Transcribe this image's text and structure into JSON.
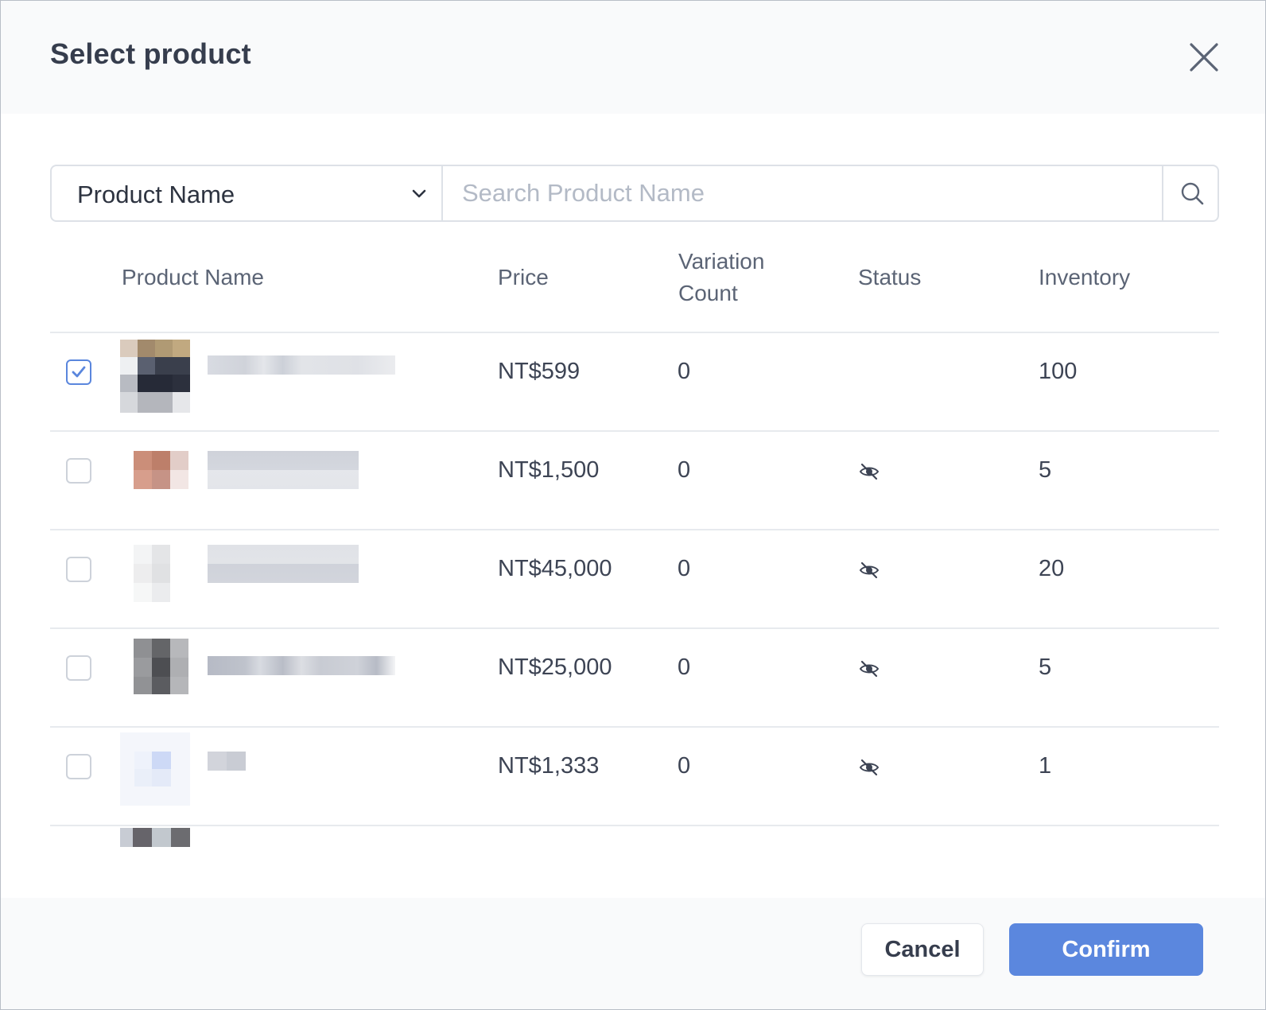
{
  "dialog": {
    "title": "Select product",
    "close_icon": "close-icon"
  },
  "search": {
    "field_selected": "Product Name",
    "placeholder": "Search Product Name",
    "value": "",
    "search_icon": "search-icon"
  },
  "table": {
    "columns": {
      "product_name": "Product Name",
      "price": "Price",
      "variation_line1": "Variation",
      "variation_line2": "Count",
      "status": "Status",
      "inventory": "Inventory"
    },
    "rows": [
      {
        "checked": true,
        "price": "NT$599",
        "variation_count": "0",
        "status_icon": "",
        "inventory": "100"
      },
      {
        "checked": false,
        "price": "NT$1,500",
        "variation_count": "0",
        "status_icon": "eye-off-icon",
        "inventory": "5"
      },
      {
        "checked": false,
        "price": "NT$45,000",
        "variation_count": "0",
        "status_icon": "eye-off-icon",
        "inventory": "20"
      },
      {
        "checked": false,
        "price": "NT$25,000",
        "variation_count": "0",
        "status_icon": "eye-off-icon",
        "inventory": "5"
      },
      {
        "checked": false,
        "price": "NT$1,333",
        "variation_count": "0",
        "status_icon": "eye-off-icon",
        "inventory": "1"
      }
    ]
  },
  "footer": {
    "cancel_label": "Cancel",
    "confirm_label": "Confirm"
  },
  "colors": {
    "accent": "#5b87de",
    "header_bg": "#f9fafb",
    "border": "#dde1e7"
  }
}
